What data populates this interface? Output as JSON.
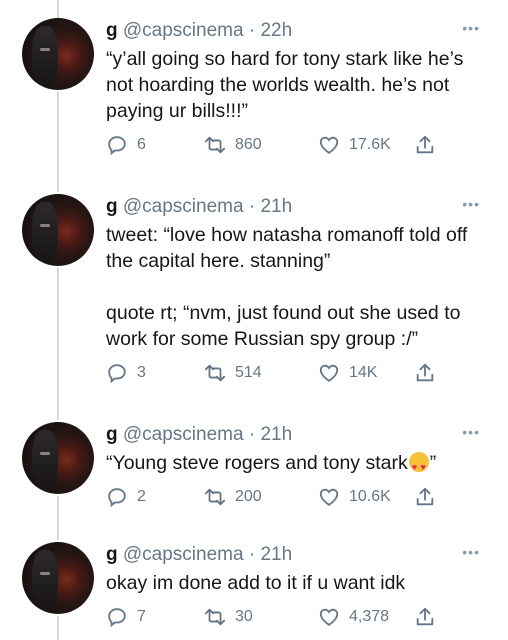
{
  "tweets": [
    {
      "name": "g",
      "handle": "@capscinema",
      "dot": "·",
      "time": "22h",
      "text": "“y’all going so hard for tony stark like he’s not hoarding the worlds wealth. he’s not paying ur bills!!!”",
      "replies": "6",
      "retweets": "860",
      "likes": "17.6K"
    },
    {
      "name": "g",
      "handle": "@capscinema",
      "dot": "·",
      "time": "21h",
      "text": "tweet: “love how natasha romanoff told off the capital here. stanning”\n\nquote rt; “nvm, just found out she used to work for some Russian spy group :/”",
      "replies": "3",
      "retweets": "514",
      "likes": "14K"
    },
    {
      "name": "g",
      "handle": "@capscinema",
      "dot": "·",
      "time": "21h",
      "text": "“Young steve rogers and tony stark",
      "text_end": "”",
      "emoji": "smiling-face-with-heart-eyes",
      "replies": "2",
      "retweets": "200",
      "likes": "10.6K"
    },
    {
      "name": "g",
      "handle": "@capscinema",
      "dot": "·",
      "time": "21h",
      "text": "okay im done add to it if u want idk",
      "replies": "7",
      "retweets": "30",
      "likes": "4,378"
    }
  ],
  "more_icon": "•••",
  "icons": {
    "reply": "reply-icon",
    "retweet": "retweet-icon",
    "like": "heart-icon",
    "share": "share-icon"
  },
  "colors": {
    "text": "#14171a",
    "secondary": "#657786",
    "thread_line": "#cfd9de"
  }
}
